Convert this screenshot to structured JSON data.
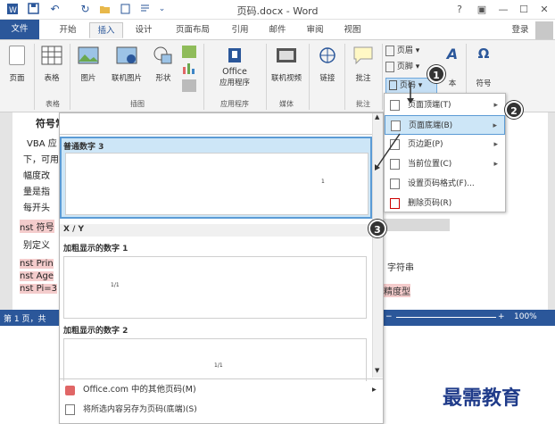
{
  "window": {
    "title": "页码.docx - Word",
    "help": "?",
    "restore": "▣",
    "minimize": "—",
    "maximize": "☐",
    "close": "✕",
    "login": "登录"
  },
  "tabs": [
    "文件",
    "开始",
    "插入",
    "设计",
    "页面布局",
    "引用",
    "邮件",
    "审阅",
    "视图"
  ],
  "ribbon": {
    "buttons": {
      "page": "页面",
      "table": "表格",
      "picture": "图片",
      "online_picture": "联机图片",
      "shape": "形状",
      "office_line1": "Office",
      "office_line2": "应用程序",
      "online_video": "联机视频",
      "link": "链接",
      "comment": "批注",
      "header": "页眉",
      "footer": "页脚",
      "page_number": "页码",
      "text_partial": "本",
      "symbol": "符号"
    },
    "groups": {
      "tables": "表格",
      "illustrations": "插图",
      "apps": "应用程序",
      "media": "媒体",
      "comments": "批注"
    }
  },
  "document": {
    "lines": [
      "符号常",
      "VBA 应",
      "下，可用",
      "幅度改",
      "量是指",
      "每开头",
      "nst 符号",
      "别定义",
      "nst Prin",
      "nst Age",
      "nst Pi=3"
    ],
    "right_text_1": "，字符串",
    "right_text_2": "精度型"
  },
  "status": {
    "page": "第 1 页，共",
    "zoom": "100%",
    "minus": "−",
    "plus": "+"
  },
  "gallery": {
    "item1_title": "普通数字 3",
    "item1_number": "1",
    "section_title": "X / Y",
    "item2_title": "加粗显示的数字 1",
    "item2_number": "1/1",
    "item3_title": "加粗显示的数字 2",
    "item3_number": "1/1",
    "more_pages": "Office.com 中的其他页码(M)",
    "save_selection": "将所选内容另存为页码(底端)(S)"
  },
  "submenu": {
    "items": [
      {
        "label": "页面顶端(T)",
        "arrow": "▸"
      },
      {
        "label": "页面底端(B)",
        "arrow": "▸"
      },
      {
        "label": "页边距(P)",
        "arrow": "▸"
      },
      {
        "label": "当前位置(C)",
        "arrow": "▸"
      },
      {
        "label": "设置页码格式(F)...",
        "arrow": ""
      },
      {
        "label": "删除页码(R)",
        "arrow": ""
      }
    ]
  },
  "badges": [
    "1",
    "2",
    "3"
  ],
  "watermark": "最需教育",
  "colors": {
    "accent": "#2b579a",
    "highlight": "#cde6f7",
    "highlight_border": "#5b9bd5"
  }
}
